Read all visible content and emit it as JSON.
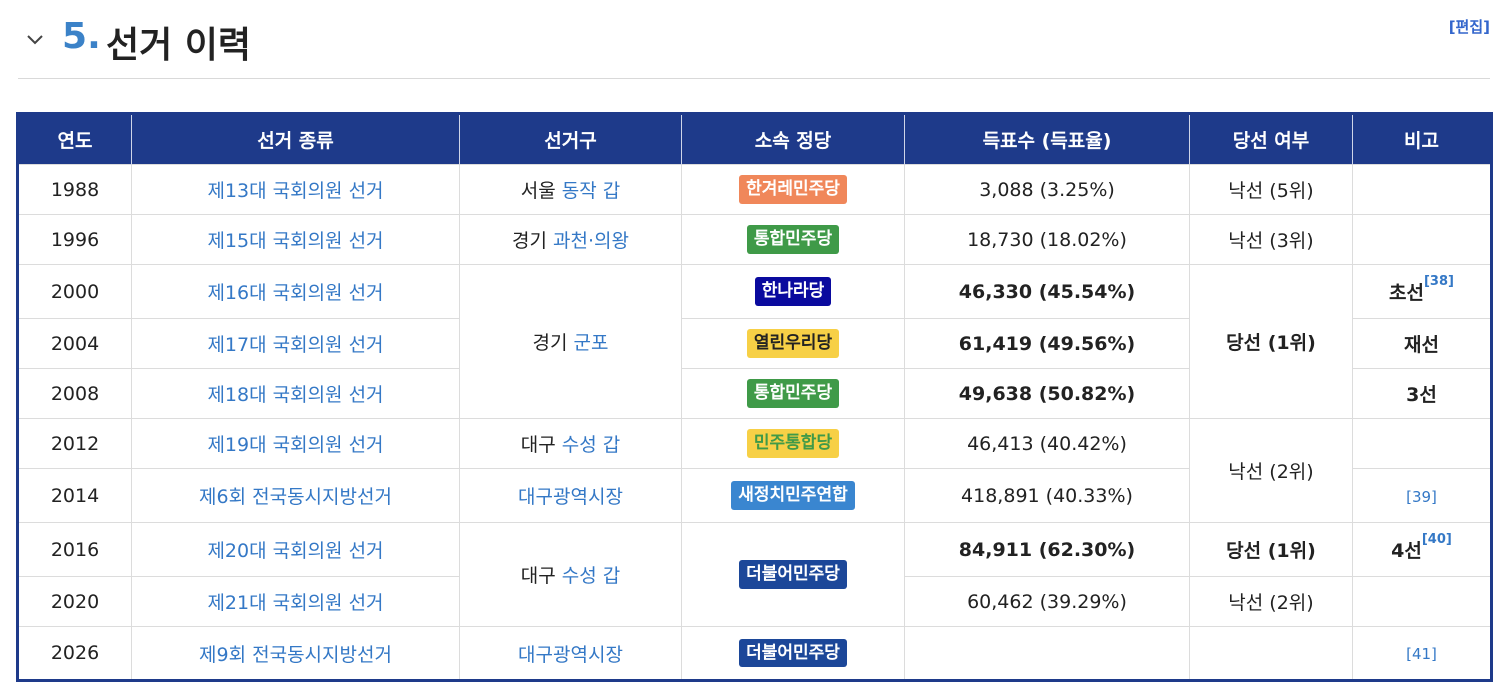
{
  "section": {
    "number": "5",
    "dot": ".",
    "title": "선거 이력",
    "edit": "[편집]"
  },
  "columns": [
    "연도",
    "선거 종류",
    "선거구",
    "소속 정당",
    "득표수 (득표율)",
    "당선 여부",
    "비고"
  ],
  "rows": [
    {
      "year": "1988",
      "election": "제13대 국회의원 선거",
      "district_prefix": "서울",
      "district_link": "동작 갑",
      "party": "한겨레민주당",
      "votes": "3,088 (3.25%)",
      "result": "낙선 (5위)"
    },
    {
      "year": "1996",
      "election": "제15대 국회의원 선거",
      "district_prefix": "경기",
      "district_link": "과천·의왕",
      "party": "통합민주당",
      "votes": "18,730 (18.02%)",
      "result": "낙선 (3위)"
    },
    {
      "year": "2000",
      "election": "제16대 국회의원 선거",
      "district_prefix": "경기",
      "district_link": "군포",
      "party": "한나라당",
      "votes": "46,330 (45.54%)",
      "result": "당선 (1위)",
      "note": "초선",
      "note_ref": "[38]"
    },
    {
      "year": "2004",
      "election": "제17대 국회의원 선거",
      "party": "열린우리당",
      "votes": "61,419 (49.56%)",
      "note": "재선"
    },
    {
      "year": "2008",
      "election": "제18대 국회의원 선거",
      "party": "통합민주당",
      "votes": "49,638 (50.82%)",
      "note": "3선"
    },
    {
      "year": "2012",
      "election": "제19대 국회의원 선거",
      "district_prefix": "대구",
      "district_link": "수성 갑",
      "party": "민주통합당",
      "votes": "46,413 (40.42%)",
      "result": "낙선 (2위)"
    },
    {
      "year": "2014",
      "election": "제6회 전국동시지방선거",
      "district_link": "대구광역시장",
      "party": "새정치민주연합",
      "votes": "418,891 (40.33%)",
      "note_ref": "[39]"
    },
    {
      "year": "2016",
      "election": "제20대 국회의원 선거",
      "district_prefix": "대구",
      "district_link": "수성 갑",
      "party": "더불어민주당",
      "votes": "84,911 (62.30%)",
      "result": "당선 (1위)",
      "note": "4선",
      "note_ref": "[40]"
    },
    {
      "year": "2020",
      "election": "제21대 국회의원 선거",
      "votes": "60,462 (39.29%)",
      "result": "낙선 (2위)"
    },
    {
      "year": "2026",
      "election": "제9회 전국동시지방선거",
      "district_link": "대구광역시장",
      "party": "더불어민주당",
      "note_ref": "[41]"
    }
  ],
  "party_colors": {
    "한겨레민주당": {
      "bg": "#f0875a",
      "fg": "#ffffff"
    },
    "통합민주당": {
      "bg": "#3f9a48",
      "fg": "#ffffff"
    },
    "한나라당": {
      "bg": "#0a0a9e",
      "fg": "#ffffff"
    },
    "열린우리당": {
      "bg": "#f7d046",
      "fg": "#222222"
    },
    "민주통합당": {
      "bg": "#f7d046",
      "fg": "#3f9a48"
    },
    "새정치민주연합": {
      "bg": "#3a86d0",
      "fg": "#ffffff"
    },
    "더불어민주당": {
      "bg": "#1c4799",
      "fg": "#ffffff"
    }
  },
  "accent": "#1e3a8a"
}
